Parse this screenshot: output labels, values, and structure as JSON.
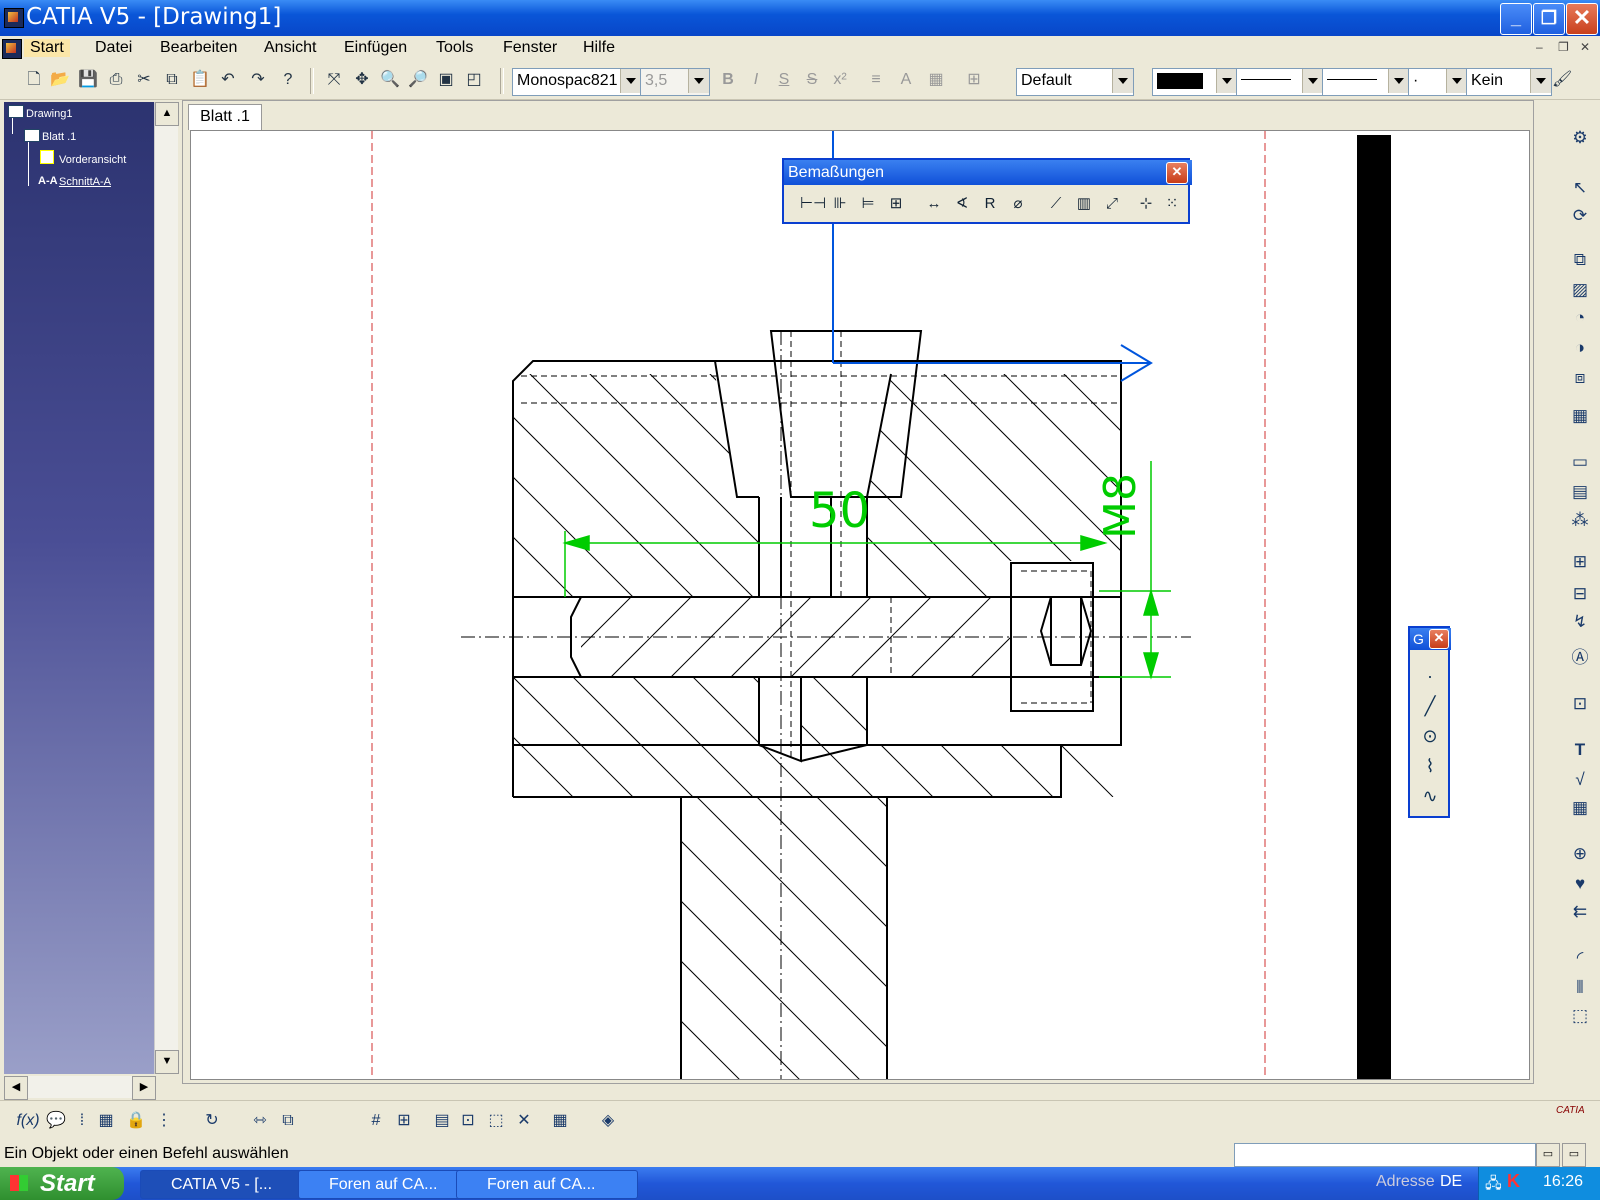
{
  "window": {
    "title": "CATIA V5 - [Drawing1]"
  },
  "menubar": {
    "items": [
      "Start",
      "Datei",
      "Bearbeiten",
      "Ansicht",
      "Einfügen",
      "Tools",
      "Fenster",
      "Hilfe"
    ]
  },
  "toolbar": {
    "font_name": "Monospac821",
    "font_size": "3,5",
    "style": "Default",
    "line_color": "#000000",
    "point_type": "·",
    "pattern": "Kein"
  },
  "tree": {
    "root": "Drawing1",
    "sheet": "Blatt .1",
    "views": [
      "Vorderansicht",
      "SchnittA-A"
    ]
  },
  "sheet_tab": "Blatt .1",
  "dimension_toolbar": {
    "title": "Bemaßungen"
  },
  "geometry_toolbar": {
    "title": "G"
  },
  "drawing": {
    "dim_length": "50",
    "dim_thread": "M8",
    "dim_color": "#00cc00",
    "axis_color": "#0055dd",
    "frame_color": "#d03030"
  },
  "status": {
    "message": "Ein Objekt oder einen Befehl auswählen"
  },
  "taskbar": {
    "start": "Start",
    "tasks": [
      "CATIA V5 - [...",
      "Foren auf CA...",
      "Foren auf CA..."
    ],
    "address_label": "Adresse",
    "lang": "DE",
    "clock": "16:26"
  },
  "brand": "CATIA"
}
